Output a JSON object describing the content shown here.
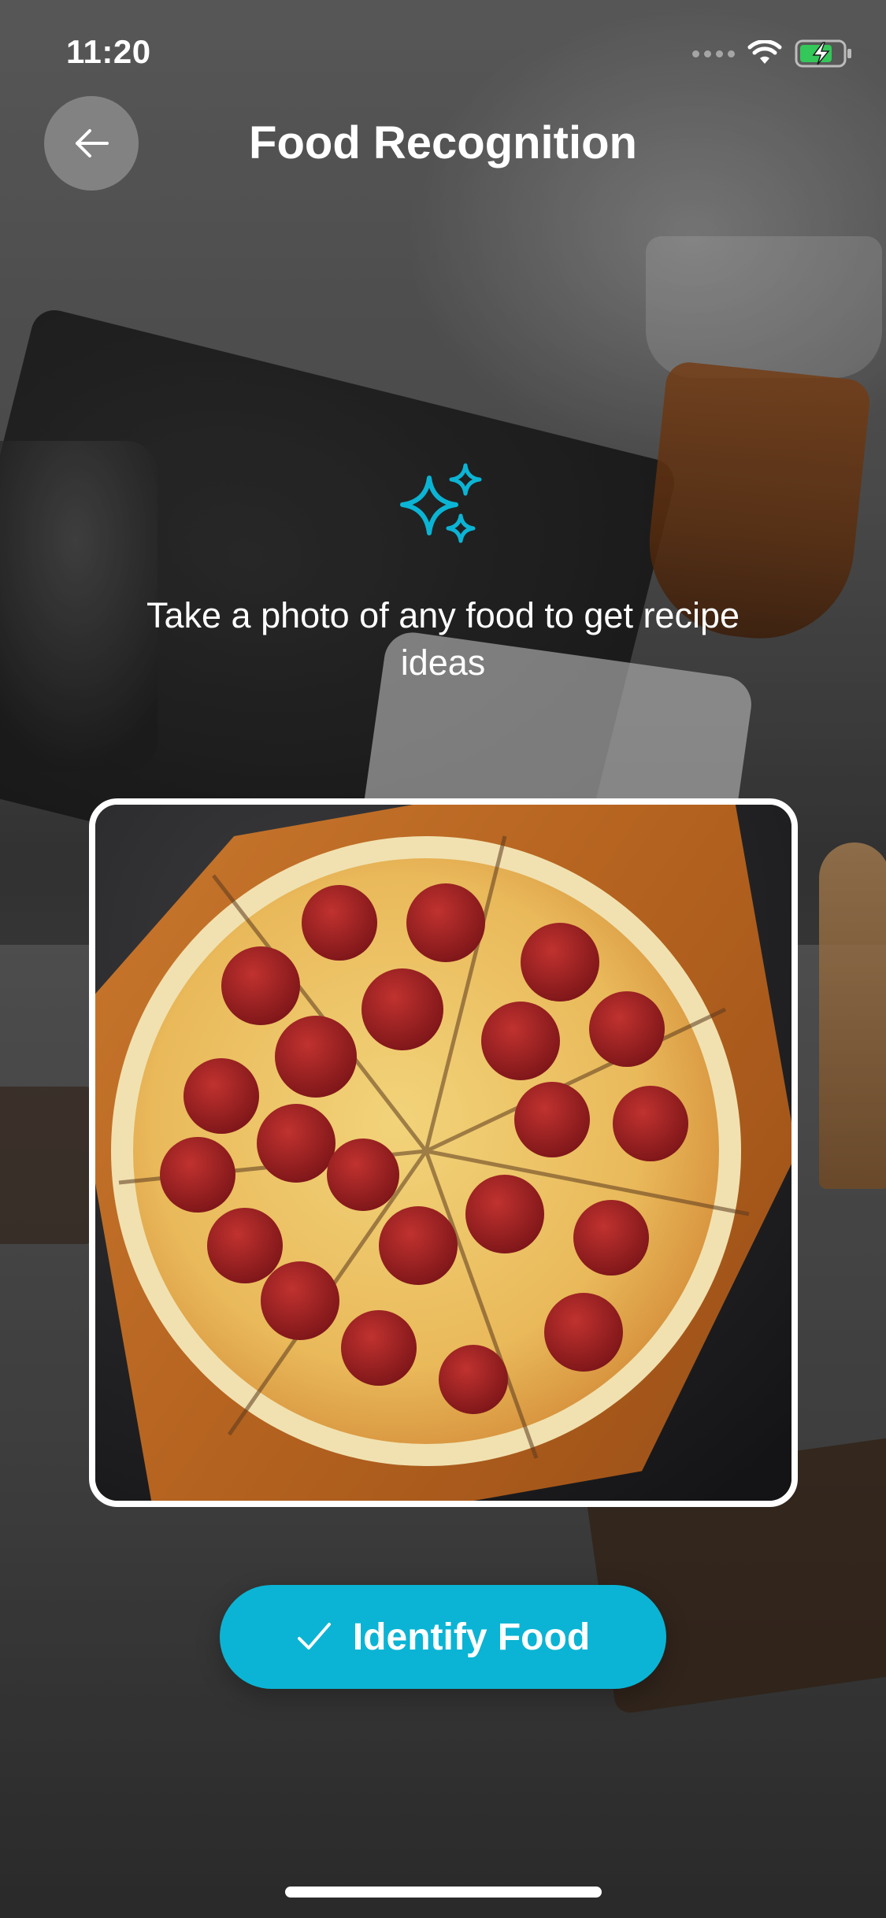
{
  "status_bar": {
    "time": "11:20"
  },
  "header": {
    "title": "Food Recognition"
  },
  "instruction": {
    "text": "Take a photo of any food to get recipe ideas"
  },
  "photo": {
    "subject": "pepperoni pizza"
  },
  "actions": {
    "identify_label": "Identify Food"
  },
  "colors": {
    "accent": "#0bb4d4",
    "battery_green": "#34c759"
  },
  "icons": [
    "back-arrow-icon",
    "sparkles-icon",
    "checkmark-icon",
    "wifi-icon",
    "battery-charging-icon",
    "cellular-signal-icon"
  ]
}
